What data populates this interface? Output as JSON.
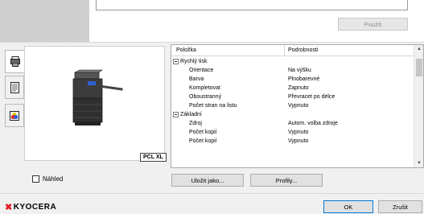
{
  "top": {
    "apply_label": "Použít"
  },
  "tabs": [
    {
      "name": "printer-tab",
      "icon": "printer-icon"
    },
    {
      "name": "document-tab",
      "icon": "document-icon"
    },
    {
      "name": "color-tab",
      "icon": "color-icon"
    }
  ],
  "preview": {
    "badge": "PCL XL"
  },
  "grid": {
    "col_item": "Položka",
    "col_details": "Podrobnosti",
    "rows": [
      {
        "item": "Rychlý tisk",
        "value": "",
        "group": true
      },
      {
        "item": "Orientace",
        "value": "Na výšku",
        "group": false
      },
      {
        "item": "Barva",
        "value": "Plnobarevné",
        "group": false
      },
      {
        "item": "Kompletovat",
        "value": "Zapnuto",
        "group": false
      },
      {
        "item": "Oboustranný",
        "value": "Převracet po délce",
        "group": false
      },
      {
        "item": "Počet stran na listu",
        "value": "Vypnuto",
        "group": false
      },
      {
        "item": "Základní",
        "value": "",
        "group": true
      },
      {
        "item": "Zdroj",
        "value": "Autom. volba zdroje",
        "group": false
      },
      {
        "item": "Počet kopií",
        "value": "Vypnuto",
        "group": false
      },
      {
        "item": "Počet kopií",
        "value": "Vypnuto",
        "group": false
      }
    ]
  },
  "preview_checkbox": {
    "label": "Náhled",
    "checked": false
  },
  "buttons": {
    "save_as": "Uložit jako...",
    "profiles": "Profily...",
    "ok": "OK",
    "cancel": "Zrušit"
  },
  "brand": {
    "logo_text": "KYOCERA"
  }
}
